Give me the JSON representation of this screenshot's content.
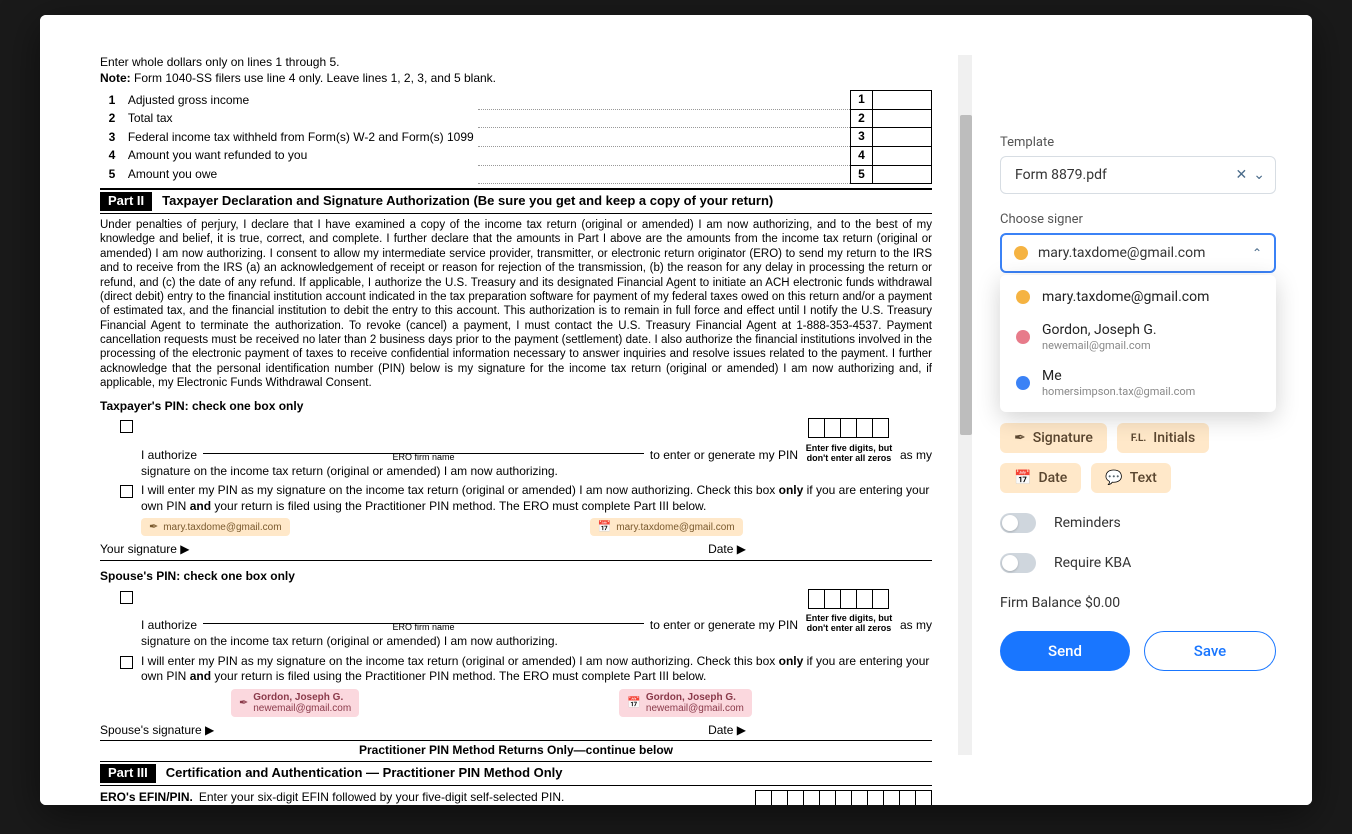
{
  "doc": {
    "header_line": "Enter whole dollars only on lines 1 through 5.",
    "note_line_prefix": "Note:",
    "note_line": "Form 1040-SS filers use line 4 only. Leave lines 1, 2, 3, and 5 blank.",
    "lines": [
      {
        "num": "1",
        "label": "Adjusted gross income"
      },
      {
        "num": "2",
        "label": "Total tax"
      },
      {
        "num": "3",
        "label": "Federal income tax withheld from Form(s) W-2 and Form(s) 1099"
      },
      {
        "num": "4",
        "label": "Amount you want refunded to you"
      },
      {
        "num": "5",
        "label": "Amount you owe"
      }
    ],
    "part2_chip": "Part II",
    "part2_title": "Taxpayer Declaration and Signature Authorization (Be sure you get and keep a copy of your return)",
    "declaration": "Under penalties of perjury, I declare that I have examined a copy of the income tax return (original or amended) I am now authorizing, and to the best of my knowledge and belief, it is true, correct, and complete. I further declare that the amounts in Part I above are the amounts from the income tax return (original or amended) I am now authorizing. I consent to allow my intermediate service provider, transmitter, or electronic return originator (ERO) to send my return to the IRS and to receive from the IRS (a) an acknowledgement of receipt or reason for rejection of the transmission, (b) the reason for any delay in processing the return or refund, and (c) the date of any refund. If applicable, I authorize the U.S. Treasury and its designated Financial Agent to initiate an ACH electronic funds withdrawal (direct debit) entry to the financial institution account indicated in the tax preparation software for payment of my federal taxes owed on this return and/or a payment of estimated tax, and the financial institution to debit the entry to this account. This authorization is to remain in full force and effect until I notify the U.S. Treasury Financial Agent to terminate the authorization. To revoke (cancel) a payment, I must contact the U.S. Treasury Financial Agent at 1-888-353-4537. Payment cancellation requests must be received no later than 2 business days prior to the payment (settlement) date. I also authorize the financial institutions involved in the processing of the electronic payment of taxes to receive confidential information necessary to answer inquiries and resolve issues related to the payment. I further acknowledge that the personal identification number (PIN) below is my signature for the income tax return (original or amended) I am now authorizing and, if applicable, my Electronic Funds Withdrawal Consent.",
    "tp_pin_head": "Taxpayer's PIN: check one box only",
    "authorize_label": "I authorize",
    "ero_caption": "ERO firm name",
    "authorize_tail": "to enter or generate my PIN",
    "as_my": "as my",
    "pin_caption": "Enter five digits, but don't enter all zeros",
    "auth_line2": "signature on the income tax return (original or amended) I am now authorizing.",
    "self_pin_prefix": "I will enter my PIN as my signature on the income tax return (original or amended) I am now authorizing. Check this box ",
    "only_word": "only",
    "self_pin_mid": " if you are entering your own PIN ",
    "and_word": "and",
    "self_pin_suffix": " your return is filed using the Practitioner PIN method. The ERO must complete Part III below.",
    "your_sig": "Your signature ▶",
    "date_label": "Date ▶",
    "spouse_pin_head": "Spouse's PIN: check one box only",
    "spouse_sig": "Spouse's signature ▶",
    "practitioner_bar": "Practitioner PIN Method Returns Only—continue below",
    "part3_chip": "Part III",
    "part3_title": "Certification and Authentication — Practitioner PIN Method Only",
    "ero_efin_prefix": "ERO's EFIN/PIN.",
    "ero_efin": "Enter your six-digit EFIN followed by your five-digit self-selected PIN.",
    "dont_enter": "Don't enter all zeros",
    "tags": {
      "mary": "mary.taxdome@gmail.com",
      "gordon_name": "Gordon, Joseph G.",
      "gordon_email": "newemail@gmail.com"
    }
  },
  "sidebar": {
    "template_label": "Template",
    "template_value": "Form 8879.pdf",
    "signer_label": "Choose signer",
    "signer_selected": "mary.taxdome@gmail.com",
    "options": [
      {
        "name": "mary.taxdome@gmail.com",
        "email": "",
        "color": "orange"
      },
      {
        "name": "Gordon, Joseph G.",
        "email": "newemail@gmail.com",
        "color": "pink"
      },
      {
        "name": "Me",
        "email": "homersimpson.tax@gmail.com",
        "color": "blue"
      }
    ],
    "pills": {
      "signature": "Signature",
      "initials": "Initials",
      "date": "Date",
      "text": "Text"
    },
    "reminders": "Reminders",
    "require_kba": "Require KBA",
    "balance_label": "Firm Balance",
    "balance_value": "$0.00",
    "send": "Send",
    "save": "Save"
  }
}
